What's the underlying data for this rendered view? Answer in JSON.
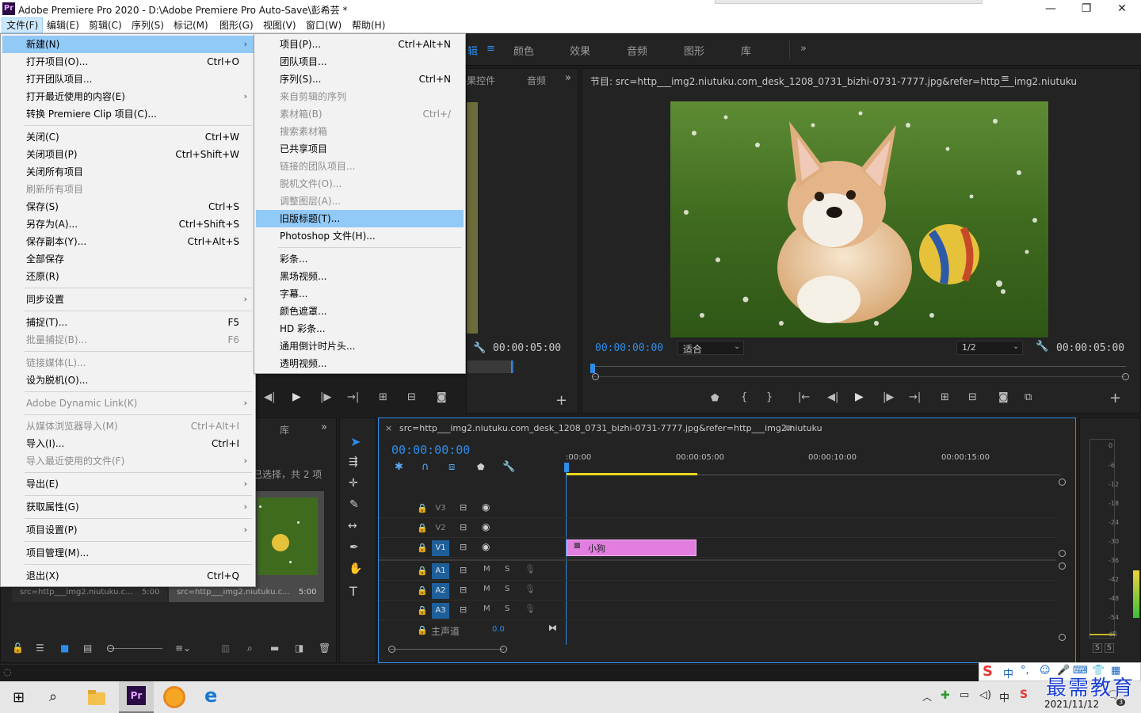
{
  "window": {
    "title": "Adobe Premiere Pro 2020 - D:\\Adobe Premiere Pro Auto-Save\\彭希芸 *",
    "app_icon": "Pr",
    "min": "—",
    "max": "❐",
    "close": "✕"
  },
  "menubar": [
    "文件(F)",
    "编辑(E)",
    "剪辑(C)",
    "序列(S)",
    "标记(M)",
    "图形(G)",
    "视图(V)",
    "窗口(W)",
    "帮助(H)"
  ],
  "workspace_tabs": {
    "partial_first": "辑",
    "items": [
      "颜色",
      "效果",
      "音频",
      "图形",
      "库"
    ],
    "more": "»"
  },
  "file_menu": [
    {
      "label": "新建(N)",
      "shortcut": "",
      "submenu": true,
      "disabled": false,
      "highlight": true
    },
    {
      "label": "打开项目(O)...",
      "shortcut": "Ctrl+O",
      "submenu": false,
      "disabled": false
    },
    {
      "label": "打开团队项目...",
      "shortcut": "",
      "submenu": false,
      "disabled": false
    },
    {
      "label": "打开最近使用的内容(E)",
      "shortcut": "",
      "submenu": true,
      "disabled": false
    },
    {
      "label": "转换 Premiere Clip 项目(C)...",
      "shortcut": "",
      "submenu": false,
      "disabled": false
    },
    {
      "sep": true
    },
    {
      "label": "关闭(C)",
      "shortcut": "Ctrl+W",
      "submenu": false,
      "disabled": false
    },
    {
      "label": "关闭项目(P)",
      "shortcut": "Ctrl+Shift+W",
      "submenu": false,
      "disabled": false
    },
    {
      "label": "关闭所有项目",
      "shortcut": "",
      "submenu": false,
      "disabled": false
    },
    {
      "label": "刷新所有项目",
      "shortcut": "",
      "submenu": false,
      "disabled": true
    },
    {
      "label": "保存(S)",
      "shortcut": "Ctrl+S",
      "submenu": false,
      "disabled": false
    },
    {
      "label": "另存为(A)...",
      "shortcut": "Ctrl+Shift+S",
      "submenu": false,
      "disabled": false
    },
    {
      "label": "保存副本(Y)...",
      "shortcut": "Ctrl+Alt+S",
      "submenu": false,
      "disabled": false
    },
    {
      "label": "全部保存",
      "shortcut": "",
      "submenu": false,
      "disabled": false
    },
    {
      "label": "还原(R)",
      "shortcut": "",
      "submenu": false,
      "disabled": false
    },
    {
      "sep": true
    },
    {
      "label": "同步设置",
      "shortcut": "",
      "submenu": true,
      "disabled": false
    },
    {
      "sep": true
    },
    {
      "label": "捕捉(T)...",
      "shortcut": "F5",
      "submenu": false,
      "disabled": false
    },
    {
      "label": "批量捕捉(B)...",
      "shortcut": "F6",
      "submenu": false,
      "disabled": true
    },
    {
      "sep": true
    },
    {
      "label": "链接媒体(L)...",
      "shortcut": "",
      "submenu": false,
      "disabled": true
    },
    {
      "label": "设为脱机(O)...",
      "shortcut": "",
      "submenu": false,
      "disabled": false
    },
    {
      "sep": true
    },
    {
      "label": "Adobe Dynamic Link(K)",
      "shortcut": "",
      "submenu": true,
      "disabled": true
    },
    {
      "sep": true
    },
    {
      "label": "从媒体浏览器导入(M)",
      "shortcut": "Ctrl+Alt+I",
      "submenu": false,
      "disabled": true
    },
    {
      "label": "导入(I)...",
      "shortcut": "Ctrl+I",
      "submenu": false,
      "disabled": false
    },
    {
      "label": "导入最近使用的文件(F)",
      "shortcut": "",
      "submenu": true,
      "disabled": true
    },
    {
      "sep": true
    },
    {
      "label": "导出(E)",
      "shortcut": "",
      "submenu": true,
      "disabled": false
    },
    {
      "sep": true
    },
    {
      "label": "获取属性(G)",
      "shortcut": "",
      "submenu": true,
      "disabled": false
    },
    {
      "sep": true
    },
    {
      "label": "项目设置(P)",
      "shortcut": "",
      "submenu": true,
      "disabled": false
    },
    {
      "sep": true
    },
    {
      "label": "项目管理(M)...",
      "shortcut": "",
      "submenu": false,
      "disabled": false
    },
    {
      "sep": true
    },
    {
      "label": "退出(X)",
      "shortcut": "Ctrl+Q",
      "submenu": false,
      "disabled": false
    }
  ],
  "new_submenu": [
    {
      "label": "项目(P)...",
      "shortcut": "Ctrl+Alt+N",
      "disabled": false
    },
    {
      "label": "团队项目...",
      "shortcut": "",
      "disabled": false
    },
    {
      "label": "序列(S)...",
      "shortcut": "Ctrl+N",
      "disabled": false
    },
    {
      "label": "来自剪辑的序列",
      "shortcut": "",
      "disabled": true
    },
    {
      "label": "素材箱(B)",
      "shortcut": "Ctrl+/",
      "disabled": true
    },
    {
      "label": "搜索素材箱",
      "shortcut": "",
      "disabled": true
    },
    {
      "label": "已共享项目",
      "shortcut": "",
      "disabled": false
    },
    {
      "label": "链接的团队项目...",
      "shortcut": "",
      "disabled": true
    },
    {
      "label": "脱机文件(O)...",
      "shortcut": "",
      "disabled": true
    },
    {
      "label": "调整图层(A)...",
      "shortcut": "",
      "disabled": true
    },
    {
      "label": "旧版标题(T)...",
      "shortcut": "",
      "disabled": false,
      "highlight": true
    },
    {
      "label": "Photoshop 文件(H)...",
      "shortcut": "",
      "disabled": false
    },
    {
      "sep": true
    },
    {
      "label": "彩条...",
      "shortcut": "",
      "disabled": false
    },
    {
      "label": "黑场视频...",
      "shortcut": "",
      "disabled": false
    },
    {
      "label": "字幕...",
      "shortcut": "",
      "disabled": false
    },
    {
      "label": "颜色遮罩...",
      "shortcut": "",
      "disabled": false
    },
    {
      "label": "HD 彩条...",
      "shortcut": "",
      "disabled": false
    },
    {
      "label": "通用倒计时片头...",
      "shortcut": "",
      "disabled": false
    },
    {
      "label": "透明视频...",
      "shortcut": "",
      "disabled": false
    }
  ],
  "source_panel": {
    "tab_partial": "果控件",
    "tab_audio": "音频",
    "more": "»",
    "duration": "00:00:05:00"
  },
  "program_monitor": {
    "title": "节目: src=http___img2.niutuku.com_desk_1208_0731_bizhi-0731-7777.jpg&refer=http___img2.niutuku",
    "menu_icon": "≡",
    "timecode": "00:00:00:00",
    "fit": "适合",
    "resolution": "1/2",
    "duration": "00:00:05:00",
    "add": "+"
  },
  "project_panel": {
    "tab_lib": "库",
    "more": "»",
    "selection": "已选择，共 2 项",
    "items": [
      {
        "name": "src=http___img2.niutuku.c...",
        "dur": "5:00"
      },
      {
        "name": "src=http___img2.niutuku.c...",
        "dur": "5:00"
      }
    ]
  },
  "timeline": {
    "close": "×",
    "title": "src=http___img2.niutuku.com_desk_1208_0731_bizhi-0731-7777.jpg&refer=http___img2.niutuku",
    "menu_icon": "≡",
    "timecode": "00:00:00:00",
    "ruler": [
      ":00:00",
      "00:00:05:00",
      "00:00:10:00",
      "00:00:15:00"
    ],
    "video_tracks": [
      "V3",
      "V2",
      "V1"
    ],
    "audio_tracks": [
      "A1",
      "A2",
      "A3"
    ],
    "track_m": "M",
    "track_s": "S",
    "master": "主声道",
    "master_vol": "0.0",
    "clip_name": "小狗"
  },
  "meter": {
    "scale": [
      "0",
      "-6",
      "-12",
      "-18",
      "-24",
      "-30",
      "-36",
      "-42",
      "-48",
      "-54",
      "dB"
    ],
    "solo": [
      "S",
      "S"
    ]
  },
  "taskbar": {
    "date": "2021/11/12",
    "ime": "中",
    "watermark": "最需教育",
    "pr_label": "Pr",
    "notif_count": "3"
  },
  "colors": {
    "accent_blue": "#2d8ceb",
    "clip_pink": "#e27ee0",
    "menu_highlight": "#91c9f7",
    "track_on": "#1e5f9a"
  }
}
